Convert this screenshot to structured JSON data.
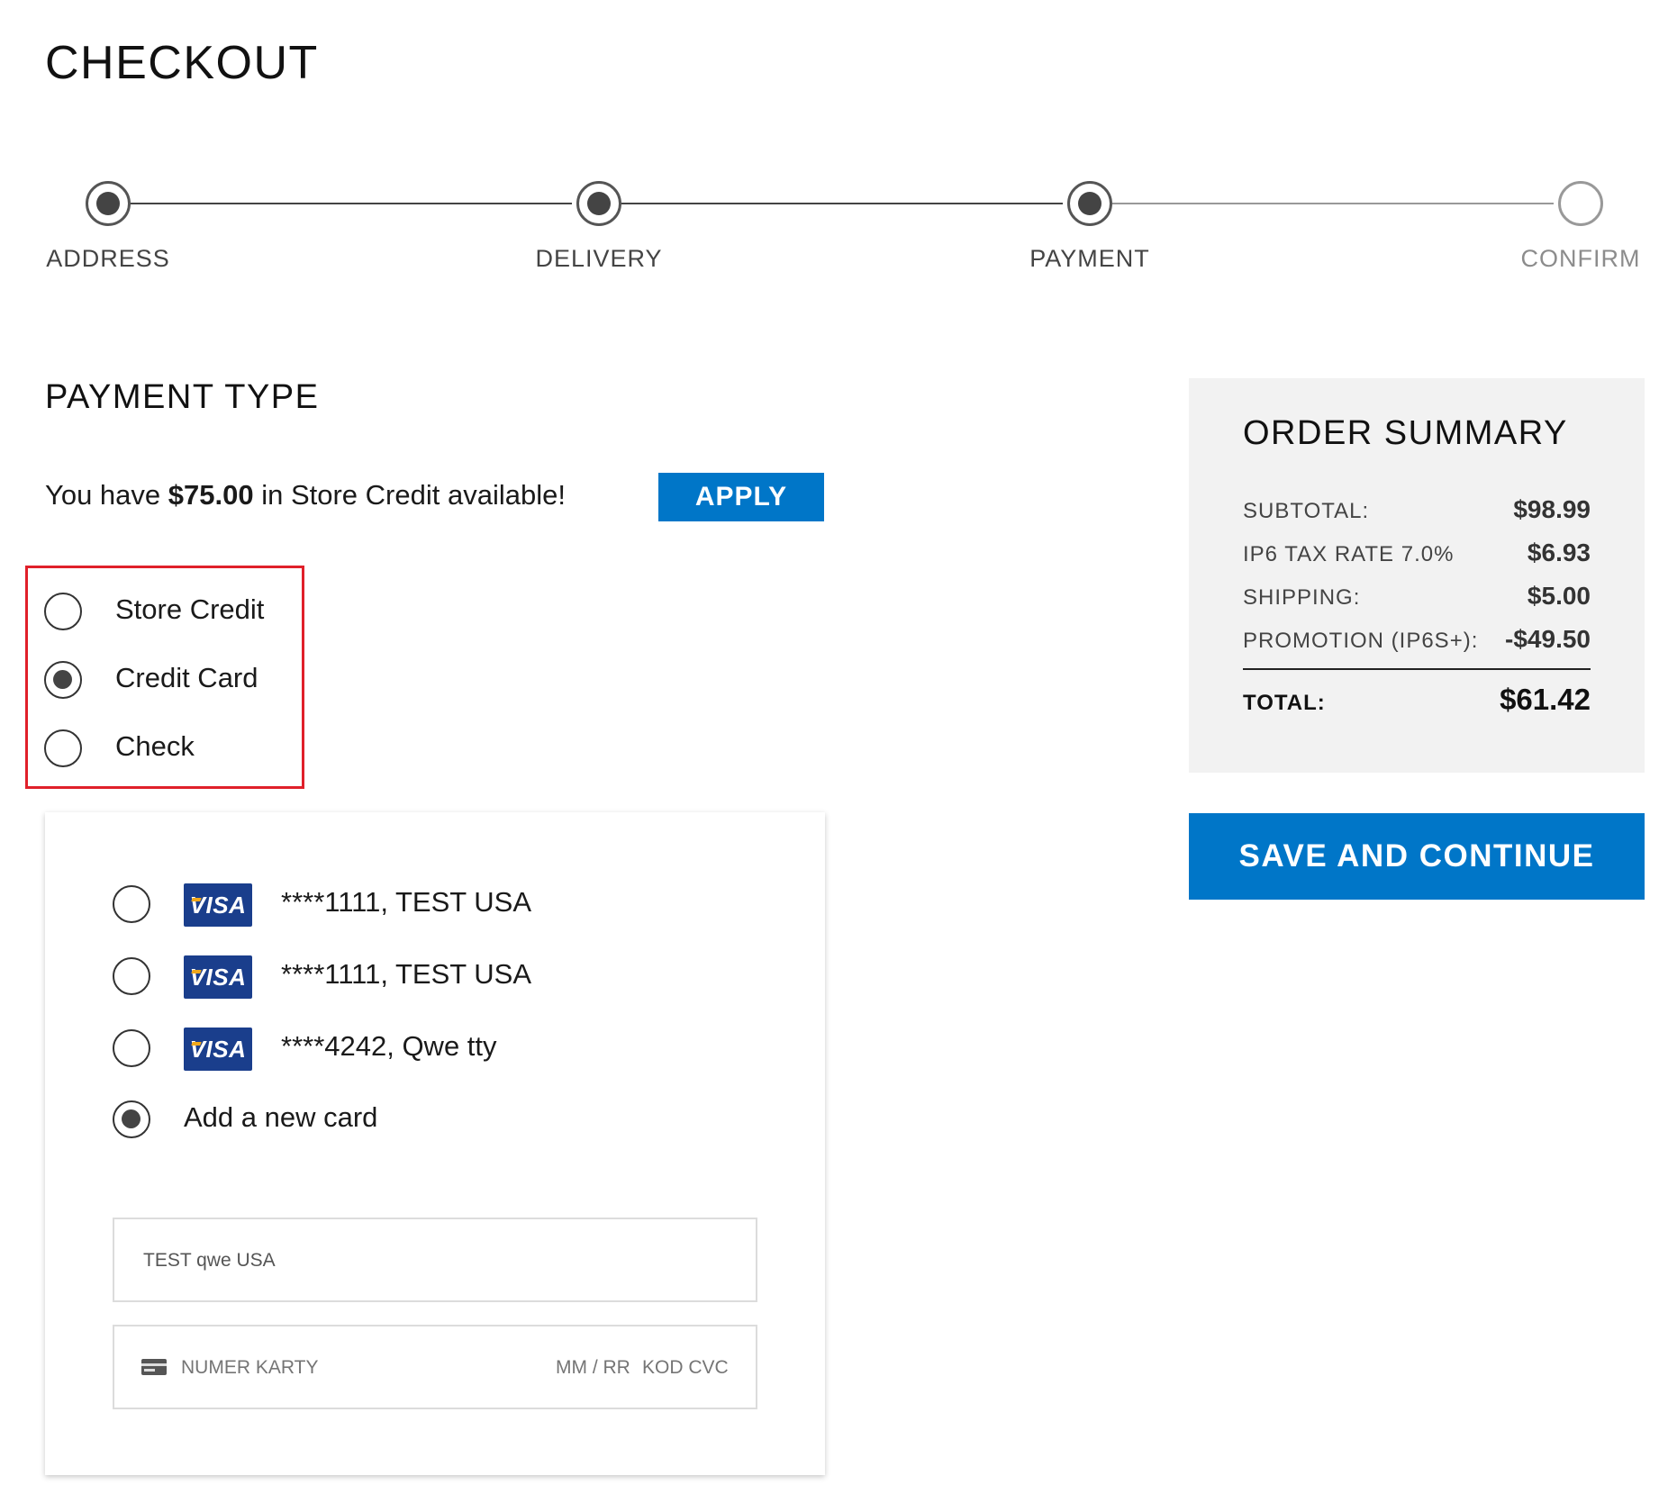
{
  "page": {
    "title": "CHECKOUT"
  },
  "stepper": {
    "steps": [
      {
        "label": "ADDRESS",
        "state": "complete"
      },
      {
        "label": "DELIVERY",
        "state": "complete"
      },
      {
        "label": "PAYMENT",
        "state": "current"
      },
      {
        "label": "CONFIRM",
        "state": "pending"
      }
    ]
  },
  "payment": {
    "title": "PAYMENT TYPE",
    "store_credit_prefix": "You have ",
    "store_credit_amount": "$75.00",
    "store_credit_suffix": " in Store Credit available!",
    "apply_label": "APPLY",
    "types": [
      {
        "label": "Store Credit",
        "selected": false
      },
      {
        "label": "Credit Card",
        "selected": true
      },
      {
        "label": "Check",
        "selected": false
      }
    ],
    "cards": [
      {
        "brand": "VISA",
        "text": "****1111,  TEST USA",
        "selected": false
      },
      {
        "brand": "VISA",
        "text": "****1111,  TEST USA",
        "selected": false
      },
      {
        "brand": "VISA",
        "text": "****4242,  Qwe tty",
        "selected": false
      }
    ],
    "add_new_card_label": "Add a new card",
    "add_new_card_selected": true,
    "cardholder_value": "TEST qwe USA",
    "card_number_placeholder": "NUMER KARTY",
    "expiry_placeholder": "MM / RR",
    "cvc_placeholder": "KOD CVC"
  },
  "summary": {
    "title": "ORDER SUMMARY",
    "rows": [
      {
        "label": "SUBTOTAL:",
        "value": "$98.99"
      },
      {
        "label": "IP6 TAX RATE 7.0%",
        "value": "$6.93"
      },
      {
        "label": "SHIPPING:",
        "value": "$5.00"
      },
      {
        "label": "PROMOTION (IP6S+):",
        "value": "-$49.50"
      }
    ],
    "total_label": "TOTAL:",
    "total_value": "$61.42"
  },
  "save_button_label": "SAVE AND CONTINUE",
  "colors": {
    "primary_button": "#0076c8",
    "highlight_border": "#e0202a",
    "summary_bg": "#f2f2f2",
    "visa_bg": "#1a3e8c"
  }
}
